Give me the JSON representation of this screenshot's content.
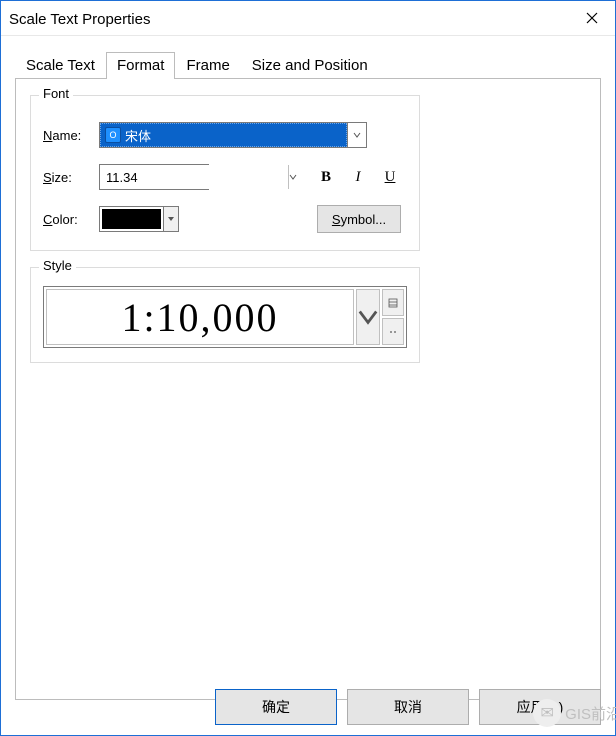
{
  "window": {
    "title": "Scale Text Properties"
  },
  "tabs": {
    "scale_text": "Scale Text",
    "format": "Format",
    "frame": "Frame",
    "size_pos": "Size and Position",
    "active": "format"
  },
  "font_group": {
    "legend": "Font",
    "name_label_prefix": "N",
    "name_label_rest": "ame:",
    "name_value": "宋体",
    "size_label_prefix": "S",
    "size_label_rest": "ize:",
    "size_value": "11.34",
    "color_label_prefix": "C",
    "color_label_rest": "olor:",
    "color_value": "#000000",
    "bold": "B",
    "italic": "I",
    "underline": "U",
    "symbol_prefix": "S",
    "symbol_rest": "ymbol..."
  },
  "style_group": {
    "legend": "Style",
    "preview": "1:10,000"
  },
  "buttons": {
    "ok": "确定",
    "cancel": "取消",
    "apply": "应用(A)"
  },
  "watermark": "GIS前沿"
}
